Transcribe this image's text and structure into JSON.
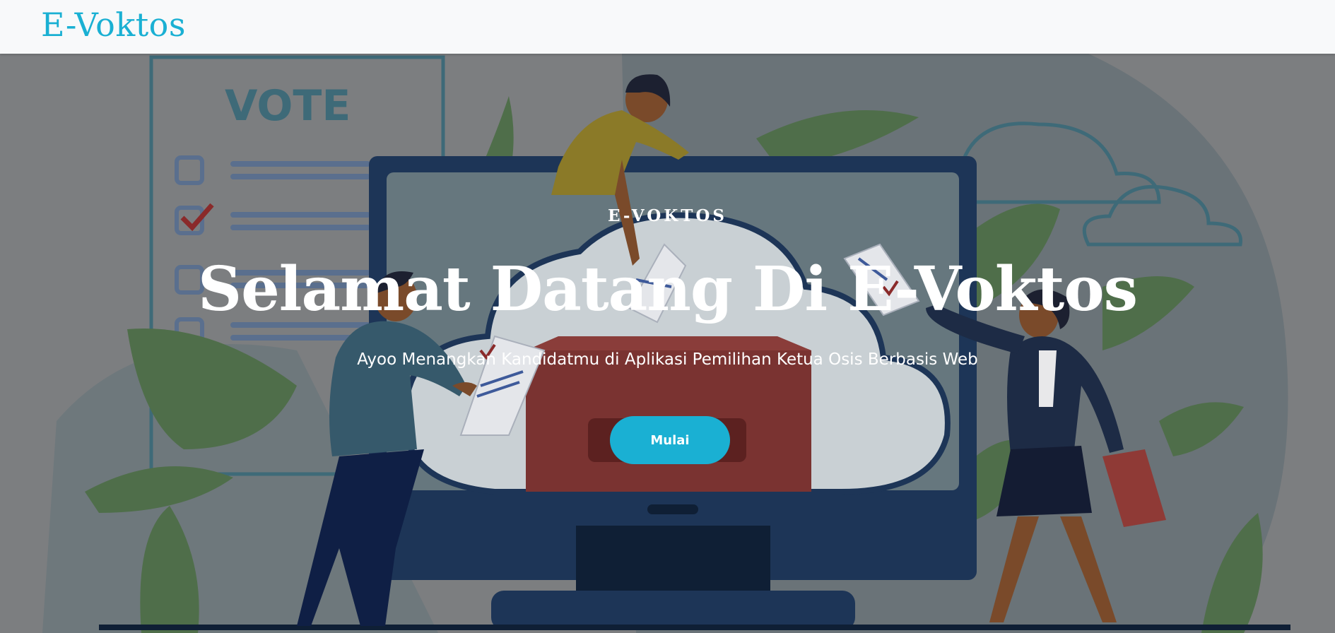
{
  "navbar": {
    "brand": "E-Voktos"
  },
  "hero": {
    "eyebrow": "E-VOKTOS",
    "headline": "Selamat Datang Di E-Voktos",
    "subtitle": "Ayoo Menangkan Kandidatmu di Aplikasi Pemilihan Ketua Osis Berbasis Web",
    "cta_label": "Mulai",
    "illustration_sign_text": "VOTE"
  },
  "colors": {
    "brand": "#1ab0d3",
    "button": "#1ab0d3",
    "navbar_bg": "#f8f9fa"
  }
}
